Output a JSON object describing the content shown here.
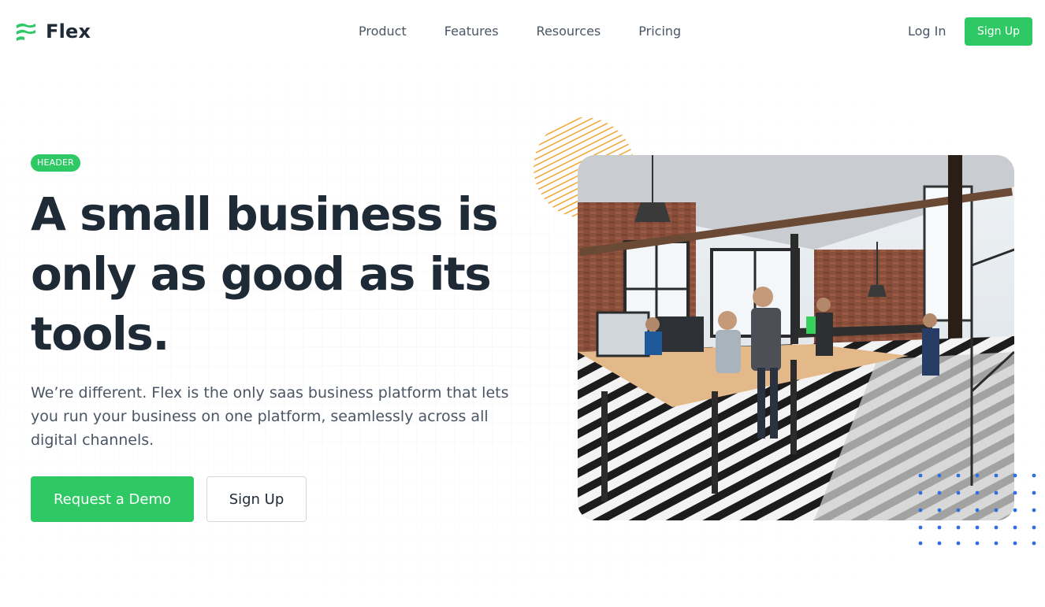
{
  "brand": {
    "name": "Flex",
    "logo_icon": "flex-logo-icon",
    "primary_color": "#2ec865",
    "text_color": "#1f2a37",
    "muted_color": "#4a5565",
    "accent_orange": "#f2a73b",
    "accent_blue": "#2f6fe0"
  },
  "nav": {
    "links": [
      {
        "label": "Product"
      },
      {
        "label": "Features"
      },
      {
        "label": "Resources"
      },
      {
        "label": "Pricing"
      }
    ],
    "login_label": "Log In",
    "signup_label": "Sign Up"
  },
  "hero": {
    "badge": "HEADER",
    "headline": "A small business is only as good as its tools.",
    "subtext": "We’re different. Flex is the only saas business platform that lets you run your business on one platform, seamlessly across all digital channels.",
    "primary_cta": "Request a Demo",
    "secondary_cta": "Sign Up",
    "image_icon": "office-photo"
  }
}
